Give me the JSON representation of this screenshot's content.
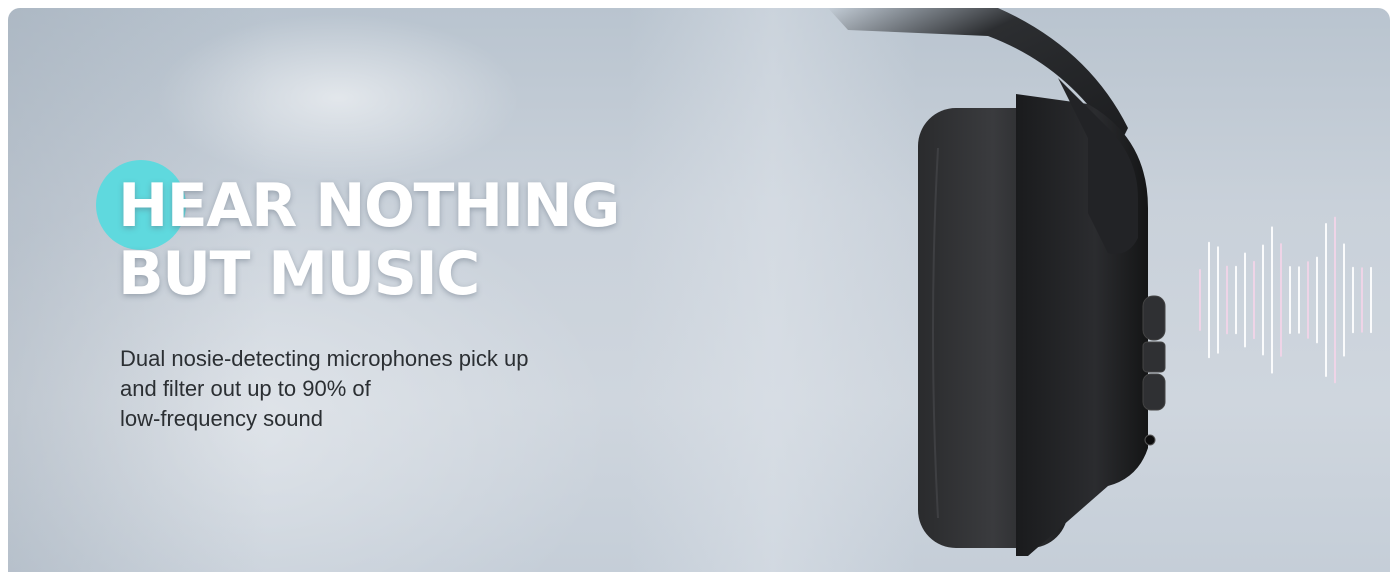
{
  "banner": {
    "headline": [
      "HEAR NOTHING",
      "BUT MUSIC"
    ],
    "description": [
      "Dual nosie-detecting microphones pick up",
      "and filter out up to 90% of",
      "low-frequency sound"
    ],
    "colors": {
      "accent": "#5fd9de",
      "headline_text": "#ffffff",
      "body_text": "#2b2f33",
      "background": "#c9d1da"
    },
    "icons": {
      "headphone": "headphone-icon",
      "soundwave": "soundwave-icon"
    }
  }
}
